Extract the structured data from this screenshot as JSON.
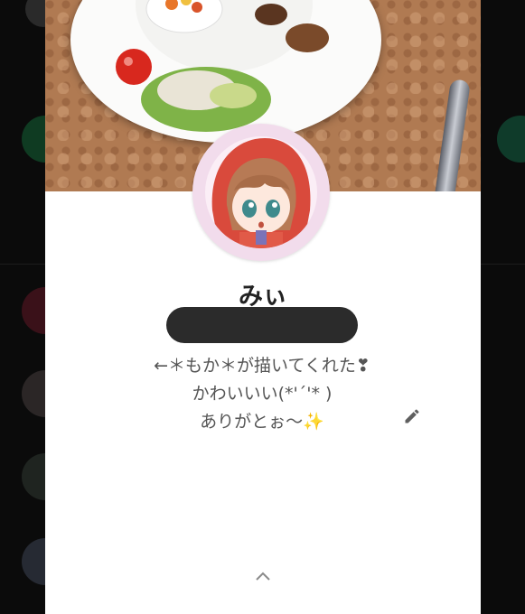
{
  "profile": {
    "name": "みぃ",
    "bio_lines": [
      "←＊もか＊が描いてくれた❣",
      "かわいいい(*'ˊ'* )",
      "ありがとぉ〜✨"
    ]
  },
  "icons": {
    "edit": "pencil-icon",
    "collapse": "chevron-up-icon"
  },
  "colors": {
    "card_background": "#ffffff",
    "name_text": "#222222",
    "bio_text": "#555555",
    "avatar_ring": "#f2dcec",
    "redaction": "#2b2b2b"
  }
}
